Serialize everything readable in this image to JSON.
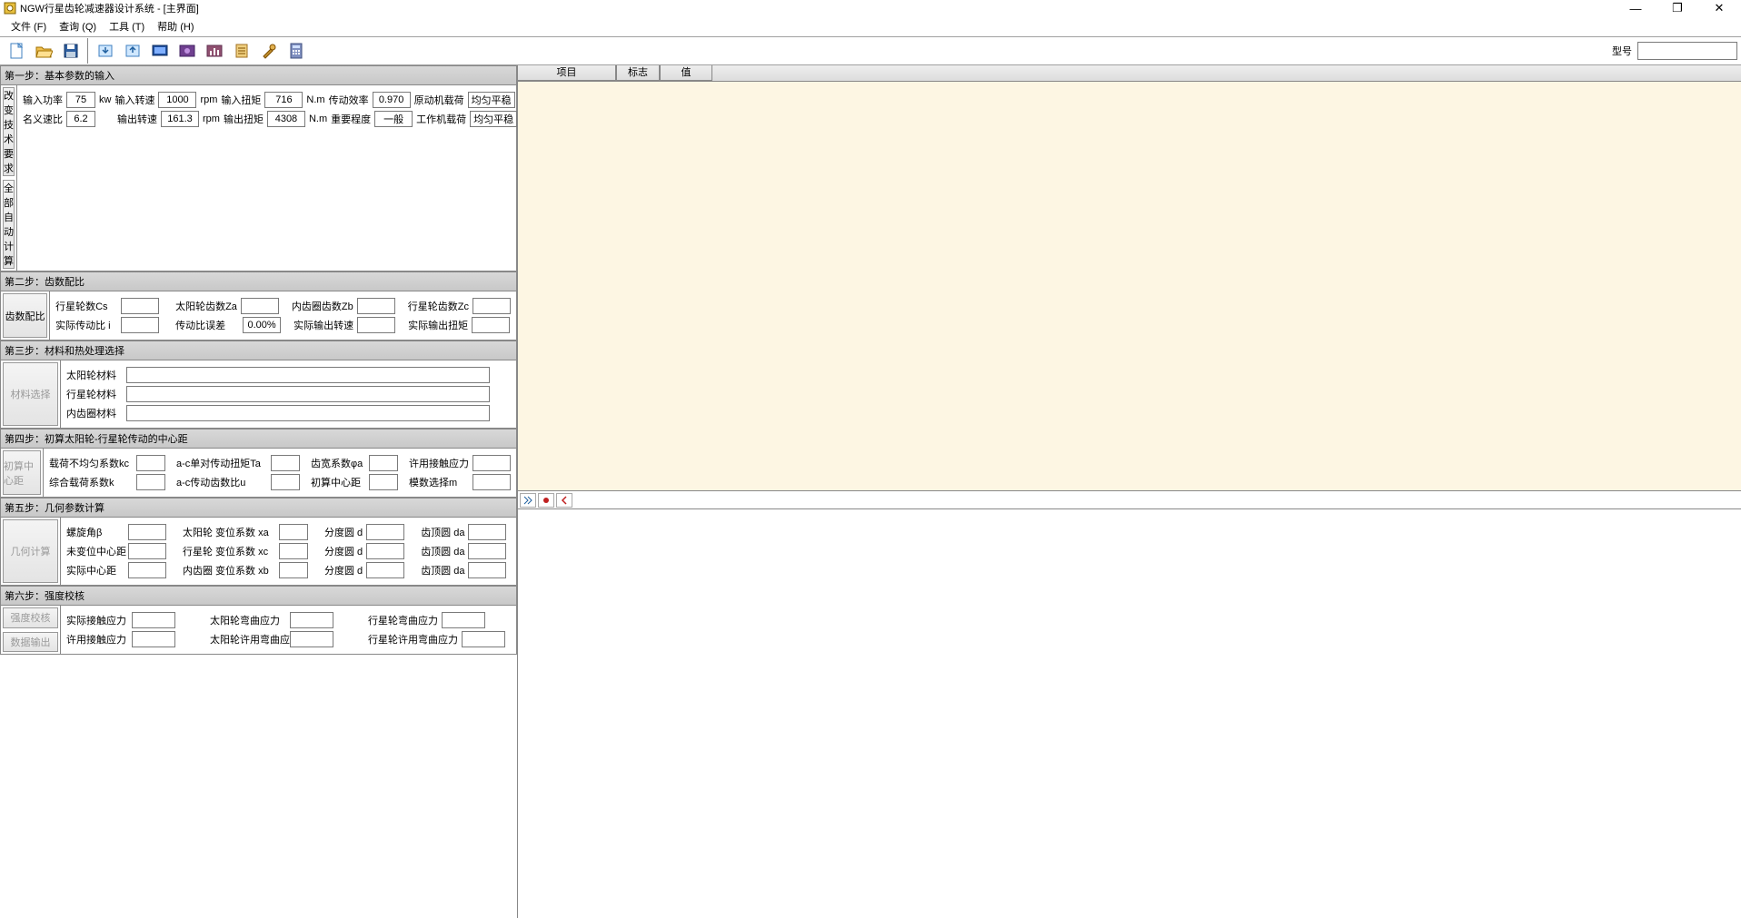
{
  "app": {
    "title": "NGW行星齿轮减速器设计系统 - [主界面]",
    "model_label": "型号"
  },
  "menu": {
    "file": "文件 (F)",
    "query": "查询 (Q)",
    "tools": "工具 (T)",
    "help": "帮助 (H)"
  },
  "window_controls": {
    "minimize": "—",
    "maximize": "❐",
    "close": "✕"
  },
  "right_panel": {
    "col_item": "项目",
    "col_flag": "标志",
    "col_value": "值"
  },
  "step1": {
    "header": "第一步：基本参数的输入",
    "btn_change_req": "改变技术要求",
    "btn_auto_calc": "全部自动计算",
    "input_power_label": "输入功率",
    "input_power_value": "75",
    "input_power_unit": "kw",
    "input_speed_label": "输入转速",
    "input_speed_value": "1000",
    "input_speed_unit": "rpm",
    "input_torque_label": "输入扭矩",
    "input_torque_value": "716",
    "input_torque_unit": "N.m",
    "trans_eff_label": "传动效率",
    "trans_eff_value": "0.970",
    "prime_load_label": "原动机载荷",
    "prime_load_value": "均匀平稳",
    "nominal_ratio_label": "名义速比",
    "nominal_ratio_value": "6.2",
    "output_speed_label": "输出转速",
    "output_speed_value": "161.3",
    "output_speed_unit": "rpm",
    "output_torque_label": "输出扭矩",
    "output_torque_value": "4308",
    "output_torque_unit": "N.m",
    "importance_label": "重要程度",
    "importance_value": "一般",
    "work_load_label": "工作机载荷",
    "work_load_value": "均匀平稳"
  },
  "step2": {
    "header": "第二步：齿数配比",
    "btn": "齿数配比",
    "planet_count_label": "行星轮数Cs",
    "sun_teeth_label": "太阳轮齿数Za",
    "ring_teeth_label": "内齿圈齿数Zb",
    "planet_teeth_label": "行星轮齿数Zc",
    "actual_ratio_label": "实际传动比 i",
    "ratio_error_label": "传动比误差",
    "ratio_error_value": "0.00%",
    "actual_output_speed_label": "实际输出转速",
    "actual_output_torque_label": "实际输出扭矩"
  },
  "step3": {
    "header": "第三步：材料和热处理选择",
    "btn": "材料选择",
    "sun_material_label": "太阳轮材料",
    "planet_material_label": "行星轮材料",
    "ring_material_label": "内齿圈材料"
  },
  "step4": {
    "header": "第四步：初算太阳轮-行星轮传动的中心距",
    "btn": "初算中心距",
    "load_uneven_label": "载荷不均匀系数kc",
    "ac_torque_label": "a-c单对传动扭矩Ta",
    "face_width_label": "齿宽系数φa",
    "allow_contact_label": "许用接触应力",
    "combined_load_label": "综合载荷系数k",
    "ac_ratio_label": "a-c传动齿数比u",
    "initial_center_label": "初算中心距",
    "module_select_label": "模数选择m"
  },
  "step5": {
    "header": "第五步：几何参数计算",
    "btn": "几何计算",
    "helix_label": "螺旋角β",
    "sun_shift_label": "太阳轮 变位系数 xa",
    "pitch_d_label": "分度圆 d",
    "tip_d_label": "齿顶圆 da",
    "unshifted_center_label": "未变位中心距",
    "planet_shift_label": "行星轮 变位系数 xc",
    "actual_center_label": "实际中心距",
    "ring_shift_label": "内齿圈 变位系数 xb"
  },
  "step6": {
    "header": "第六步：强度校核",
    "btn_check": "强度校核",
    "btn_output": "数据输出",
    "actual_contact_label": "实际接触应力",
    "sun_bending_label": "太阳轮弯曲应力",
    "planet_bending_label": "行星轮弯曲应力",
    "allow_contact_label": "许用接触应力",
    "sun_allow_bending_label": "太阳轮许用弯曲应力",
    "planet_allow_bending_label": "行星轮许用弯曲应力"
  }
}
